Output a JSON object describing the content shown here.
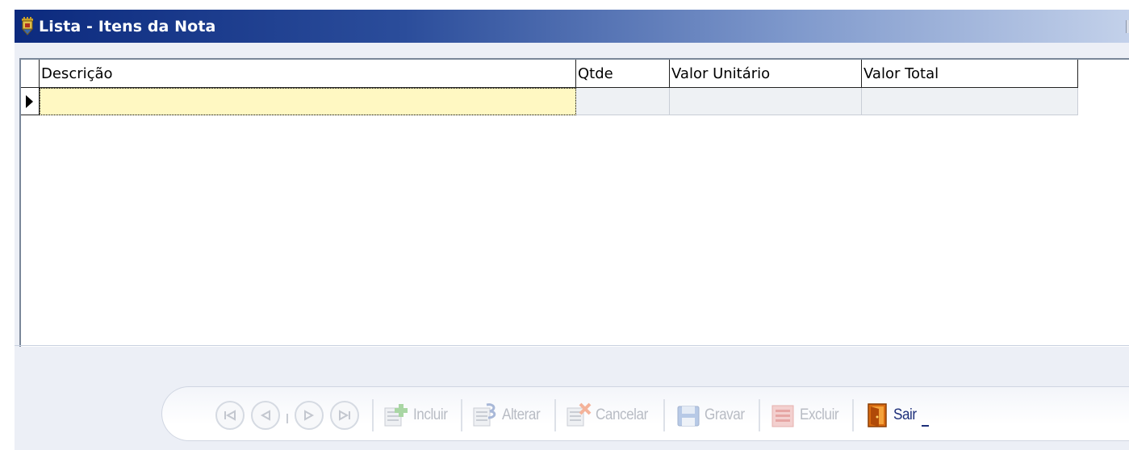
{
  "window": {
    "title": "Lista - Itens da Nota",
    "app_icon": "castle-crest-icon"
  },
  "grid": {
    "columns": [
      {
        "label": "Descrição"
      },
      {
        "label": "Qtde"
      },
      {
        "label": "Valor Unitário"
      },
      {
        "label": "Valor Total"
      }
    ],
    "rows": [
      {
        "descricao": "",
        "qtde": "",
        "valor_unitario": "",
        "valor_total": ""
      }
    ],
    "row_indicator_icon": "current-row-arrow-icon",
    "active_cell_color": "#fff8c2"
  },
  "toolbar": {
    "nav": {
      "first_icon": "first-record-icon",
      "prior_icon": "prior-record-icon",
      "next_icon": "next-record-icon",
      "last_icon": "last-record-icon"
    },
    "buttons": {
      "incluir": {
        "label": "Incluir",
        "icon": "add-record-icon",
        "enabled": false
      },
      "alterar": {
        "label": "Alterar",
        "icon": "edit-record-icon",
        "enabled": false
      },
      "cancelar": {
        "label": "Cancelar",
        "icon": "cancel-record-icon",
        "enabled": false
      },
      "gravar": {
        "label": "Gravar",
        "icon": "save-disk-icon",
        "enabled": false
      },
      "excluir": {
        "label": "Excluir",
        "icon": "delete-record-icon",
        "enabled": false
      },
      "sair": {
        "label": "Sair",
        "icon": "exit-door-icon",
        "enabled": true
      }
    },
    "disabled_text_color": "#b8bcc4",
    "enabled_text_color": "#1d2f7a"
  },
  "colors": {
    "titlebar_start": "#0c2a7e",
    "titlebar_end": "#c3d1ea",
    "client_background": "#eceff6"
  }
}
